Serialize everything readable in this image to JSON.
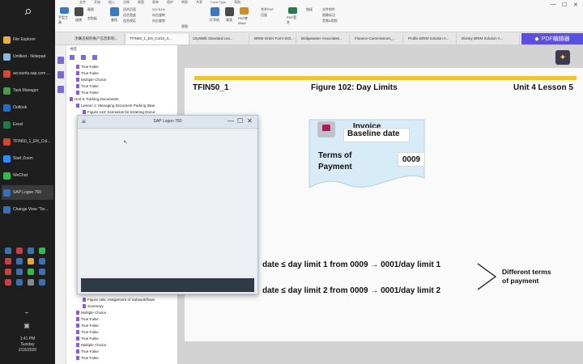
{
  "taskbar": {
    "search_icon": "search-icon",
    "items": [
      {
        "label": "File Explorer",
        "color": "#e8b33b"
      },
      {
        "label": "Untitled - Notepad",
        "color": "#8fb7d8"
      },
      {
        "label": "accounts.sap.com ...",
        "color": "#d14a3b"
      },
      {
        "label": "Task Manager",
        "color": "#4b9a4b"
      },
      {
        "label": "Outlook",
        "color": "#1f6fc4"
      },
      {
        "label": "Excel",
        "color": "#1f7a44"
      },
      {
        "label": "TFIN50_1_EN_Col...",
        "color": "#d0462f"
      },
      {
        "label": "Start Zoom",
        "color": "#2d8cff"
      },
      {
        "label": "WeChat",
        "color": "#2dbd4e"
      },
      {
        "label": "SAP Logon 760",
        "color": "#3b6fb6"
      },
      {
        "label": "Change View \"Ter...",
        "color": "#3b6fb6"
      }
    ],
    "clock": {
      "time": "1:41 PM",
      "day": "Sunday",
      "date": "2/16/2020"
    }
  },
  "ribbon": {
    "tabs": [
      "文件",
      "开始",
      "插入",
      "注释",
      "视图",
      "表单",
      "保护",
      "转换",
      "共享",
      "Corel Type",
      "帮助"
    ],
    "labels": [
      "手型工具",
      "选择",
      "截图",
      "剪贴板",
      "查找",
      "适合页面",
      "适合宽度",
      "适合视区",
      "212.51%",
      "向左旋转",
      "向右旋转",
      "视图",
      "打字机",
      "高亮",
      "PDF转Word",
      "合并PDF",
      "页面",
      "PDF签名",
      "链接",
      "文件附件",
      "图像标注",
      "音频&视频"
    ]
  },
  "tabs": [
    "涉嫌违规的账户信息影响...",
    "TFIN50_1_EN_Col15_S...",
    "CityWalk Standard Lea...",
    "BRIM-Order Form-SOl...",
    "Bridgewater-Associates...",
    "Finance-Commissions_...",
    "Profile BRIM Solution A...",
    "Disney BRIM Solution A..."
  ],
  "pdf_editor_label": "PDF编辑器",
  "bookmarks": {
    "header": "书签",
    "items": [
      {
        "label": "True False",
        "level": 2
      },
      {
        "label": "True False",
        "level": 2
      },
      {
        "label": "Multiple Choice",
        "level": 2
      },
      {
        "label": "True False",
        "level": 2
      },
      {
        "label": "True False",
        "level": 2
      },
      {
        "label": "Unit 6: Parking Documents",
        "level": 1
      },
      {
        "label": "Lesson 1: Managing Document Parking (Bas",
        "level": 2
      },
      {
        "label": "Figure 143: Scenarios for Entering Docur",
        "level": 3
      }
    ],
    "items_bottom": [
      {
        "label": "Figure 165: Assignment of Subworkflows",
        "level": 3
      },
      {
        "label": "Summary",
        "level": 3
      },
      {
        "label": "Multiple Choice",
        "level": 2
      },
      {
        "label": "True False",
        "level": 2
      },
      {
        "label": "True False",
        "level": 2
      },
      {
        "label": "True False",
        "level": 2
      },
      {
        "label": "True False",
        "level": 2
      },
      {
        "label": "Multiple Choice",
        "level": 2
      },
      {
        "label": "True False",
        "level": 2
      },
      {
        "label": "True False",
        "level": 2
      }
    ]
  },
  "page": {
    "header_left": "TFIN50_1",
    "header_center": "Figure 102: Day Limits",
    "header_right": "Unit 4 Lesson 5",
    "invoice_label": "Invoice",
    "baseline_label": "Baseline date",
    "terms_label_1": "Terms of",
    "terms_label_2": "Payment",
    "terms_value": "0009",
    "rule1": "date ≤ day limit 1 from 0009 → 0001/day limit 1",
    "rule2": "date ≤ day limit 2 from 0009 → 0001/day limit 2",
    "diff_1": "Different terms",
    "diff_2": "of payment"
  },
  "sap_window": {
    "menu_icon": "≡",
    "title": "SAP Logon 760",
    "minimize": "—",
    "maximize": "☐",
    "close": "✕"
  }
}
